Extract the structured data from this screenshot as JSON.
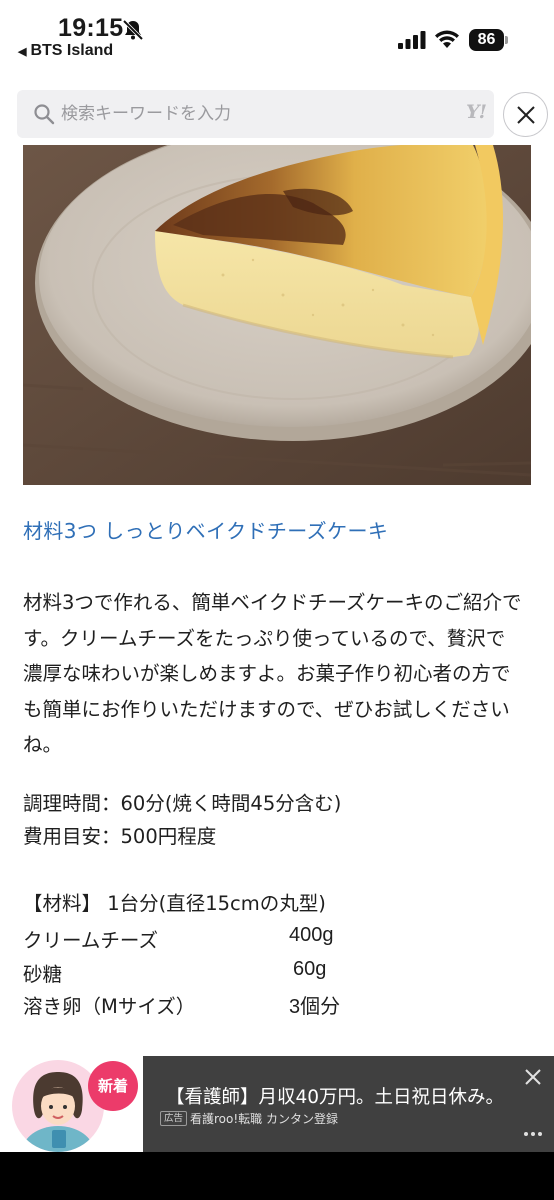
{
  "status_bar": {
    "time": "19:15",
    "back_app": "BTS Island",
    "battery": "86"
  },
  "search": {
    "placeholder": "検索キーワードを入力",
    "logo_text": "Y!"
  },
  "hero_image": {
    "subject": "baked-cheesecake-slice-photo"
  },
  "article": {
    "title": "材料3つ しっとりベイクドチーズケーキ",
    "lead": "材料3つで作れる、簡単ベイクドチーズケーキのご紹介です。クリームチーズをたっぷり使っているので、贅沢で濃厚な味わいが楽しめますよ。お菓子作り初心者の方でも簡単にお作りいただけますので、ぜひお試しくださいね。",
    "cook_time": "調理時間：60分(焼く時間45分含む)",
    "cost": "費用目安：500円程度",
    "ingredients_heading": "【材料】 1台分(直径15cmの丸型)",
    "ingredients": [
      {
        "name": "クリームチーズ",
        "qty": "400g"
      },
      {
        "name": "砂糖",
        "qty": "60g"
      },
      {
        "name": "溶き卵（Mサイズ）",
        "qty": "3個分"
      }
    ]
  },
  "ad": {
    "badge": "新着",
    "headline": "【看護師】月収40万円。土日祝日休み。",
    "label": "広告",
    "source": "看護roo!転職 カンタン登録"
  },
  "colors": {
    "title_link": "#2f6fb7",
    "ad_background": "#404040",
    "ad_badge": "#ec3b6a"
  }
}
